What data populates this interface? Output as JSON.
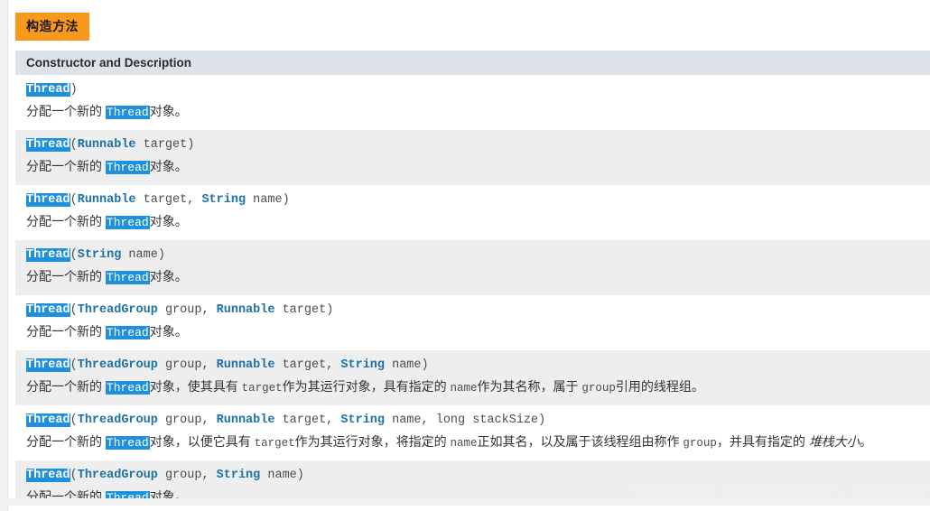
{
  "document": {
    "tab_label": "构造方法",
    "column_header": "Constructor and Description",
    "highlight_token": "Thread",
    "watermark": "https://blog.csdn.net/weixin_51818357"
  },
  "constructors": [
    {
      "name": "Thread",
      "open_paren": "(",
      "params_raw": ")",
      "signature": "Thread()",
      "tokens": [],
      "desc_prefix": "分配一个新的 ",
      "desc_code": "Thread",
      "desc_suffix": "对象。",
      "description": "分配一个新的 Thread对象。",
      "row_shade": "base"
    },
    {
      "name": "Thread",
      "signature": "Thread(Runnable target)",
      "type1": "Runnable",
      "arg1": " target",
      "close": ")",
      "desc_prefix": "分配一个新的 ",
      "desc_code": "Thread",
      "desc_suffix": "对象。",
      "description": "分配一个新的 Thread对象。",
      "row_shade": "alt"
    },
    {
      "name": "Thread",
      "signature": "Thread(Runnable target, String name)",
      "type1": "Runnable",
      "arg1": " target, ",
      "type2": "String",
      "arg2": " name",
      "close": ")",
      "desc_prefix": "分配一个新的 ",
      "desc_code": "Thread",
      "desc_suffix": "对象。",
      "description": "分配一个新的 Thread对象。",
      "row_shade": "base"
    },
    {
      "name": "Thread",
      "signature": "Thread(String name)",
      "type1": "String",
      "arg1": " name",
      "close": ")",
      "desc_prefix": "分配一个新的 ",
      "desc_code": "Thread",
      "desc_suffix": "对象。",
      "description": "分配一个新的 Thread对象。",
      "row_shade": "alt"
    },
    {
      "name": "Thread",
      "signature": "Thread(ThreadGroup group, Runnable target)",
      "type1": "ThreadGroup",
      "arg1": " group, ",
      "type2": "Runnable",
      "arg2": " target",
      "close": ")",
      "desc_prefix": "分配一个新的 ",
      "desc_code": "Thread",
      "desc_suffix": "对象。",
      "description": "分配一个新的 Thread对象。",
      "row_shade": "base"
    },
    {
      "name": "Thread",
      "signature": "Thread(ThreadGroup group, Runnable target, String name)",
      "type1": "ThreadGroup",
      "arg1": " group, ",
      "type2": "Runnable",
      "arg2": " target, ",
      "type3": "String",
      "arg3": " name",
      "close": ")",
      "description": "分配一个新的 Thread对象，使其具有 target作为其运行对象，具有指定的 name作为其名称，属于 group引用的线程组。",
      "desc_parts": {
        "p1": "分配一个新的 ",
        "c1": "Thread",
        "p2": "对象，使其具有 ",
        "c2": "target",
        "p3": "作为其运行对象，具有指定的 ",
        "c3": "name",
        "p4": "作为其名称，属于 ",
        "c4": "group",
        "p5": "引用的线程组。"
      },
      "row_shade": "alt"
    },
    {
      "name": "Thread",
      "signature": "Thread(ThreadGroup group, Runnable target, String name, long stackSize)",
      "type1": "ThreadGroup",
      "arg1": " group, ",
      "type2": "Runnable",
      "arg2": " target, ",
      "type3": "String",
      "arg3": " name, ",
      "type4": "long",
      "arg4": " stackSize",
      "close": ")",
      "description": "分配一个新的 Thread对象，以便它具有 target作为其运行对象，将指定的 name正如其名，以及属于该线程组由称作 group ，并具有指定的 堆栈大小 。",
      "desc_parts": {
        "p1": "分配一个新的 ",
        "c1": "Thread",
        "p2": "对象，以便它具有 ",
        "c2": "target",
        "p3": "作为其运行对象，将指定的 ",
        "c3": "name",
        "p4": "正如其名，以及属于该线程组由称作 ",
        "c4": "group",
        "p5": "，并具有指定的 ",
        "i5": "堆栈大小",
        "p6": "。"
      },
      "row_shade": "base"
    },
    {
      "name": "Thread",
      "signature": "Thread(ThreadGroup group, String name)",
      "type1": "ThreadGroup",
      "arg1": " group, ",
      "type2": "String",
      "arg2": " name",
      "close": ")",
      "desc_prefix": "分配一个新的 ",
      "desc_code": "Thread",
      "desc_suffix": "对象。",
      "description": "分配一个新的 Thread对象。",
      "row_shade": "alt"
    }
  ],
  "colors": {
    "tab_background": "#f8981d",
    "header_background": "#dee3e9",
    "highlight_background": "#1e90dd",
    "link_text": "#1c71a8",
    "code_text": "#4c4c4c",
    "row_alt_background": "#eeeeee",
    "row_base_background": "#ffffff",
    "page_background": "#f2f2f2"
  }
}
